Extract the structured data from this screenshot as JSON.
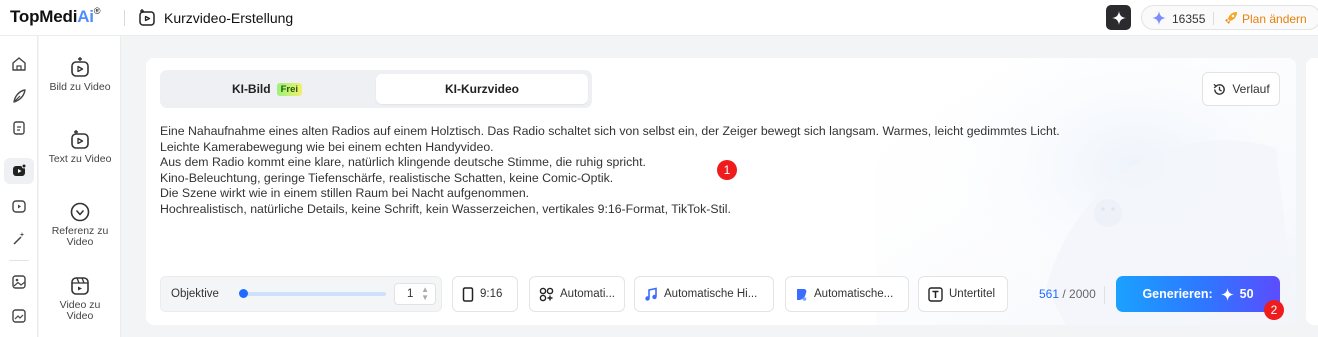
{
  "header": {
    "logo_main": "TopMedi",
    "logo_ai": "Ai",
    "logo_reg": "®",
    "title": "Kurzvideo-Erstellung",
    "credits": "16355",
    "plan_label": "Plan ändern"
  },
  "rail": {
    "icons": [
      "home-icon",
      "feather-icon",
      "clipboard-icon",
      "video-ai-icon",
      "video-plus-icon",
      "magic-wand-icon",
      "image-icon",
      "image-edit-icon"
    ]
  },
  "tools": [
    {
      "label": "Bild zu Video",
      "icon": "image-to-video-icon"
    },
    {
      "label": "Text zu Video",
      "icon": "text-to-video-icon"
    },
    {
      "label": "Referenz zu Video",
      "icon": "reference-to-video-icon"
    },
    {
      "label": "Video zu Video",
      "icon": "video-to-video-icon"
    }
  ],
  "tabs": {
    "image_label": "KI-Bild",
    "free_badge": "Frei",
    "video_label": "KI-Kurzvideo",
    "active": "video"
  },
  "history_label": "Verlauf",
  "prompt": {
    "lines": [
      "Eine Nahaufnahme eines alten Radios auf einem Holztisch. Das Radio schaltet sich von selbst ein, der Zeiger bewegt sich langsam. Warmes, leicht gedimmtes Licht.",
      "Leichte Kamerabewegung wie bei einem echten Handyvideo.",
      "Aus dem Radio kommt eine klare, natürlich klingende deutsche Stimme, die ruhig spricht.",
      "Kino-Beleuchtung, geringe Tiefenschärfe, realistische Schatten, keine Comic-Optik.",
      "Die Szene wirkt wie in einem stillen Raum bei Nacht aufgenommen.",
      "Hochrealistisch, natürliche Details, keine Schrift, kein Wasserzeichen, vertikales 9:16-Format, TikTok-Stil."
    ]
  },
  "controls": {
    "objective_label": "Objektive",
    "objective_value": "1",
    "aspect_ratio": "9:16",
    "style": "Automati...",
    "music": "Automatische Hi...",
    "voice": "Automatische...",
    "subtitle": "Untertitel"
  },
  "counter": {
    "current": "561",
    "max": "2000",
    "separator": " / "
  },
  "generate": {
    "label": "Generieren:",
    "cost": "50"
  },
  "markers": [
    "1",
    "2"
  ],
  "colors": {
    "accent_blue": "#1e6bff",
    "plan_orange": "#e8810a",
    "marker_red": "#ee1c1c"
  }
}
